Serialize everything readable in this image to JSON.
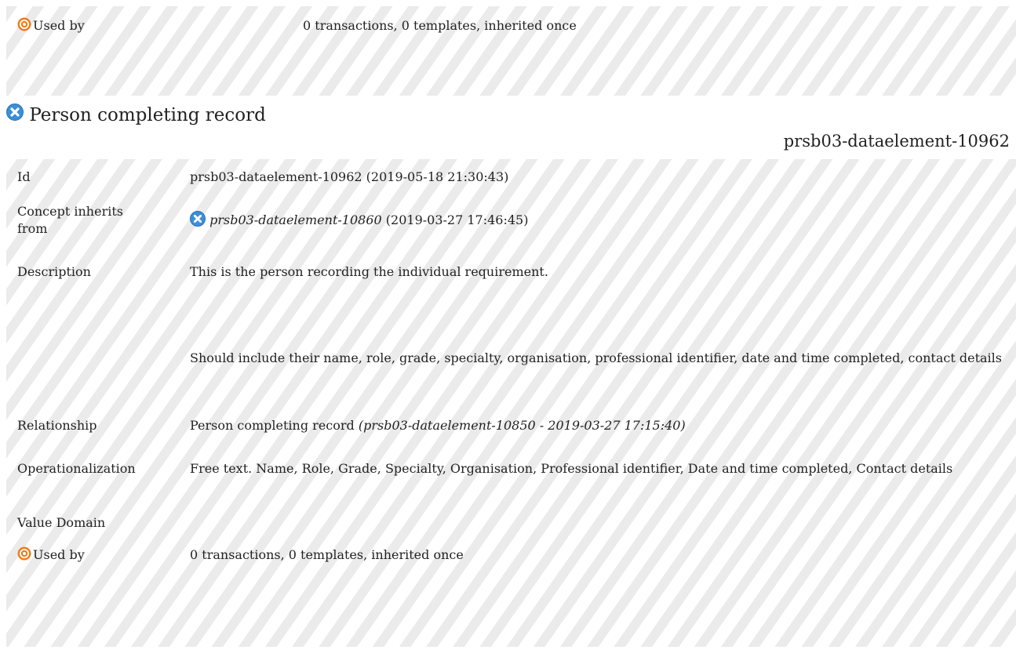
{
  "top_section": {
    "used_by_label": "Used by",
    "used_by_value": "0 transactions, 0 templates, inherited once"
  },
  "concept": {
    "title": "Person completing record",
    "id_header": "prsb03-dataelement-10962",
    "rows": {
      "id_label": "Id",
      "id_value": "prsb03-dataelement-10962 (2019-05-18 21:30:43)",
      "inherits_label": "Concept inherits from",
      "inherits_link": "prsb03-dataelement-10860",
      "inherits_date": "(2019-03-27 17:46:45)",
      "description_label": "Description",
      "description_p1": "This is the person recording the individual requirement.",
      "description_p2": "Should include their name, role, grade, specialty, organisation, professional identifier, date and time completed, contact details",
      "relationship_label": "Relationship",
      "relationship_value": "Person completing record",
      "relationship_ref": "(prsb03-dataelement-10850 - 2019-03-27 17:15:40)",
      "operationalization_label": "Operationalization",
      "operationalization_value": "Free text. Name, Role, Grade, Specialty, Organisation, Professional identifier, Date and time completed, Contact details",
      "value_domain_label": "Value Domain",
      "value_domain_value": "",
      "used_by_label": "Used by",
      "used_by_value": "0 transactions, 0 templates, inherited once"
    }
  },
  "icons": {
    "used_by": "target-icon",
    "concept_status": "x-circle-icon"
  },
  "colors": {
    "target_orange": "#f07c1c",
    "x_blue": "#3b8fd9",
    "hatch_stripe": "#ebebeb",
    "text": "#222222"
  }
}
